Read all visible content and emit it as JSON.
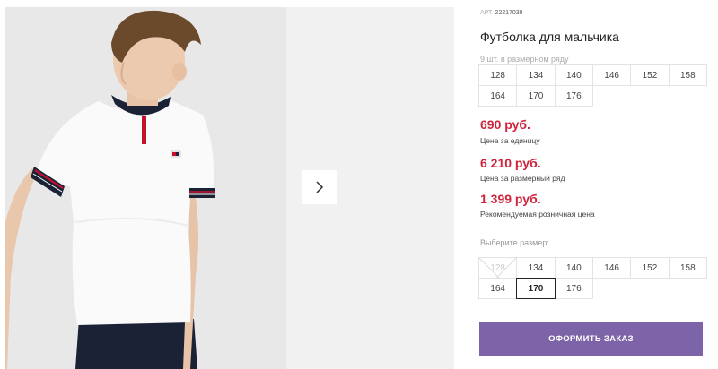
{
  "product": {
    "sku_label": "АРТ.",
    "sku": "22217038",
    "title": "Футболка для мальчика",
    "pack_label": "9 шт. в размерном ряду"
  },
  "pack_sizes": [
    "128",
    "134",
    "140",
    "146",
    "152",
    "158",
    "164",
    "170",
    "176"
  ],
  "prices": {
    "unit_price": "690 руб.",
    "unit_label": "Цена за единицу",
    "pack_price": "6 210 руб.",
    "pack_label": "Цена за размерный ряд",
    "retail_price": "1 399 руб.",
    "retail_label": "Рекомендуемая розничная цена"
  },
  "size_select": {
    "label": "Выберите размер:",
    "options": [
      {
        "label": "128",
        "state": "unavailable"
      },
      {
        "label": "134",
        "state": "available"
      },
      {
        "label": "140",
        "state": "available"
      },
      {
        "label": "146",
        "state": "available"
      },
      {
        "label": "152",
        "state": "available"
      },
      {
        "label": "158",
        "state": "available"
      },
      {
        "label": "164",
        "state": "available"
      },
      {
        "label": "170",
        "state": "selected"
      },
      {
        "label": "176",
        "state": "available"
      }
    ]
  },
  "actions": {
    "order_label": "ОФОРМИТЬ ЗАКАЗ"
  },
  "colors": {
    "accent": "#7d64a8",
    "price": "#d0243c"
  },
  "icons": {
    "next": "chevron-right-icon"
  }
}
